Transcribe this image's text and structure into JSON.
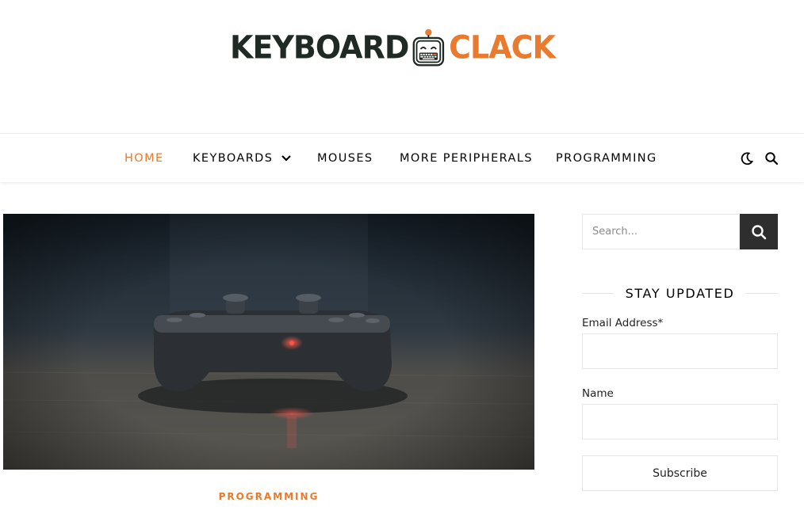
{
  "brand": {
    "word_left": "KEYBOARD",
    "word_right": "CLACK",
    "mascot_icon": "robot-keyboard-icon",
    "colors": {
      "dark": "#1f2a24",
      "accent": "#e97a2e"
    }
  },
  "nav": {
    "items": [
      {
        "label": "HOME",
        "active": true
      },
      {
        "label": "KEYBOARDS",
        "has_dropdown": true
      },
      {
        "label": "MOUSES"
      },
      {
        "label": "MORE PERIPHERALS"
      },
      {
        "label": "PROGRAMMING"
      }
    ],
    "icons": [
      "moon-icon",
      "search-icon"
    ]
  },
  "post": {
    "image_subject": "game-controller-photo",
    "category": "PROGRAMMING"
  },
  "sidebar": {
    "search": {
      "placeholder": "Search...",
      "button_icon": "search-icon"
    },
    "newsletter": {
      "title": "STAY UPDATED",
      "email_label": "Email Address*",
      "name_label": "Name",
      "subscribe_label": "Subscribe"
    }
  },
  "colors": {
    "accent": "#e97a2e",
    "search_button": "#2e2e2e",
    "border": "#e6e6e6"
  }
}
